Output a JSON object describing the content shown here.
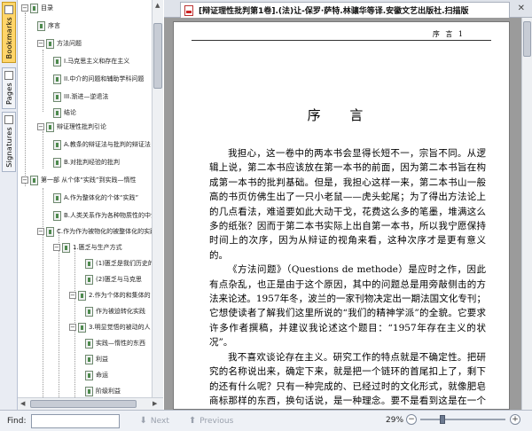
{
  "sidebar": {
    "tabs": [
      {
        "label": "Bookmarks",
        "icon": "bookmarks-icon"
      },
      {
        "label": "Pages",
        "icon": "pages-icon"
      },
      {
        "label": "Signatures",
        "icon": "signatures-icon"
      }
    ]
  },
  "bookmarks": [
    {
      "label": "目录",
      "expander": "−"
    },
    {
      "label": "序言",
      "expander": ""
    },
    {
      "label": "方法问题",
      "expander": "−"
    },
    {
      "label": "I.马克思主义和存在主义",
      "expander": ""
    },
    {
      "label": "II.中介的问题和辅助学科问题",
      "expander": ""
    },
    {
      "label": "III.渐进—逆退法",
      "expander": ""
    },
    {
      "label": "结论",
      "expander": ""
    },
    {
      "label": "辩证理性批判引论",
      "expander": "−"
    },
    {
      "label": "A.教条的辩证法与批判的辩证法",
      "expander": ""
    },
    {
      "label": "B.对批判经验的批判",
      "expander": ""
    },
    {
      "label": "第一部 从个体“实践”到实践—惰性",
      "expander": "−"
    },
    {
      "label": "A.作为整体化的个体“实践”",
      "expander": ""
    },
    {
      "label": "B.人类关系作为各种物质性的中介",
      "expander": ""
    },
    {
      "label": "C.作为作为被物化的被整体化的实践",
      "expander": "−"
    },
    {
      "label": "1.匮乏与生产方式",
      "expander": "−"
    },
    {
      "label": "(1)匮乏是我们历史的",
      "expander": ""
    },
    {
      "label": "(2)匮乏与马克思",
      "expander": ""
    },
    {
      "label": "2.作为个体的和集体的",
      "expander": "−"
    },
    {
      "label": "作为被迫转化实践",
      "expander": ""
    },
    {
      "label": "3.明显觉悟的被动的人",
      "expander": "−"
    },
    {
      "label": "实践—惰性的东西",
      "expander": ""
    },
    {
      "label": "利益",
      "expander": ""
    },
    {
      "label": "命运",
      "expander": ""
    },
    {
      "label": "阶级利益",
      "expander": ""
    }
  ],
  "document": {
    "tab_title": "[辩证理性批判第1卷].(法)让-保罗·萨特.林骧华等译.安徽文艺出版社.扫描版",
    "running_head": "序 言  1",
    "chapter_title": "序    言",
    "paragraphs": [
      "我担心，这一卷中的两本书会显得长短不一，宗旨不同。从逻辑上说，第二本书应该放在第一本书的前面，因为第二本书旨在构成第一本书的批判基础。但是，我担心这样一来，第二本书山一般高的书页仿佛生出了一只小老鼠——虎头蛇尾；为了得出方法论上的几点看法，难道要如此大动干戈，花费这么多的笔墨，堆满这么多的纸张？因而于第二本书实际上出自第一本书，所以我宁愿保持时间上的次序，因为从辩证的视角来看，这种次序才是更有意义的。",
      "《方法问题》（Questions de methode）是应时之作，因此有点杂乱，也正是由于这个原因，其中的问题总是用旁敲侧击的方法来论述。1957年冬，波兰的一家刊物决定出一期法国文化专刊；它想使读者了解我们这里所说的“我们的精神学派”的全貌。它要求许多作者撰稿，并建议我论述这个题目：“1957年存在主义的状况”。",
      "我不喜欢谈论存在主义。研究工作的特点就是不确定性。把研究的名称说出来，确定下来，就是把一个链环的首尾扣上了，剩下的还有什么呢？只有一种完成的、已经过时的文化形式，就像肥皂商标那样的东西，换句话说，是一种理念。要不是看到这是在一个马克思主义文化的国家里表达当今哲学中的矛盾的一种方法，我就会拒绝我的波兰朋友们的要求了。出于这一目的，我觉得能够围绕一种主要的对立把使哲学分裂的内部冲突集中在一起，这个"
    ]
  },
  "findbar": {
    "label": "Find:",
    "input_value": "",
    "next_label": "Next",
    "previous_label": "Previous",
    "zoom": "29%"
  },
  "colors": {
    "active_tab": "#ffd56a",
    "viewer_bg": "#9b9b9b",
    "bookmark_icon": "#4d8a4d"
  }
}
